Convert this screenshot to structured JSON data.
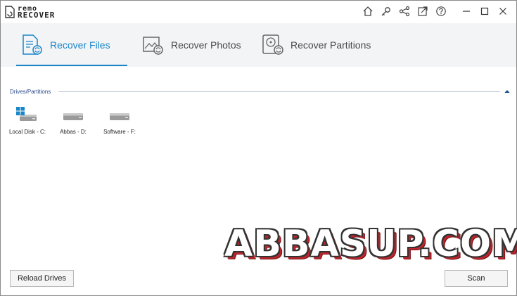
{
  "app": {
    "logo_line1": "remo",
    "logo_line2": "RECOVER"
  },
  "titlebar_icons": [
    "home-icon",
    "key-icon",
    "share-icon",
    "export-icon",
    "help-icon"
  ],
  "window_controls": [
    "minimize-icon",
    "maximize-icon",
    "close-icon"
  ],
  "tabs": [
    {
      "label": "Recover Files",
      "icon": "recover-files-icon",
      "active": true
    },
    {
      "label": "Recover Photos",
      "icon": "recover-photos-icon",
      "active": false
    },
    {
      "label": "Recover Partitions",
      "icon": "recover-partitions-icon",
      "active": false
    }
  ],
  "section": {
    "title": "Drives/Partitions"
  },
  "drives": [
    {
      "label": "Local Disk - C:",
      "icon": "windows-drive-icon"
    },
    {
      "label": "Abbas - D:",
      "icon": "drive-icon"
    },
    {
      "label": "Software - F:",
      "icon": "drive-icon"
    }
  ],
  "watermark": "ABBASUP.COM",
  "buttons": {
    "reload": "Reload Drives",
    "scan": "Scan"
  },
  "colors": {
    "accent": "#1a86c8",
    "tab_bg": "#f3f4f6"
  }
}
